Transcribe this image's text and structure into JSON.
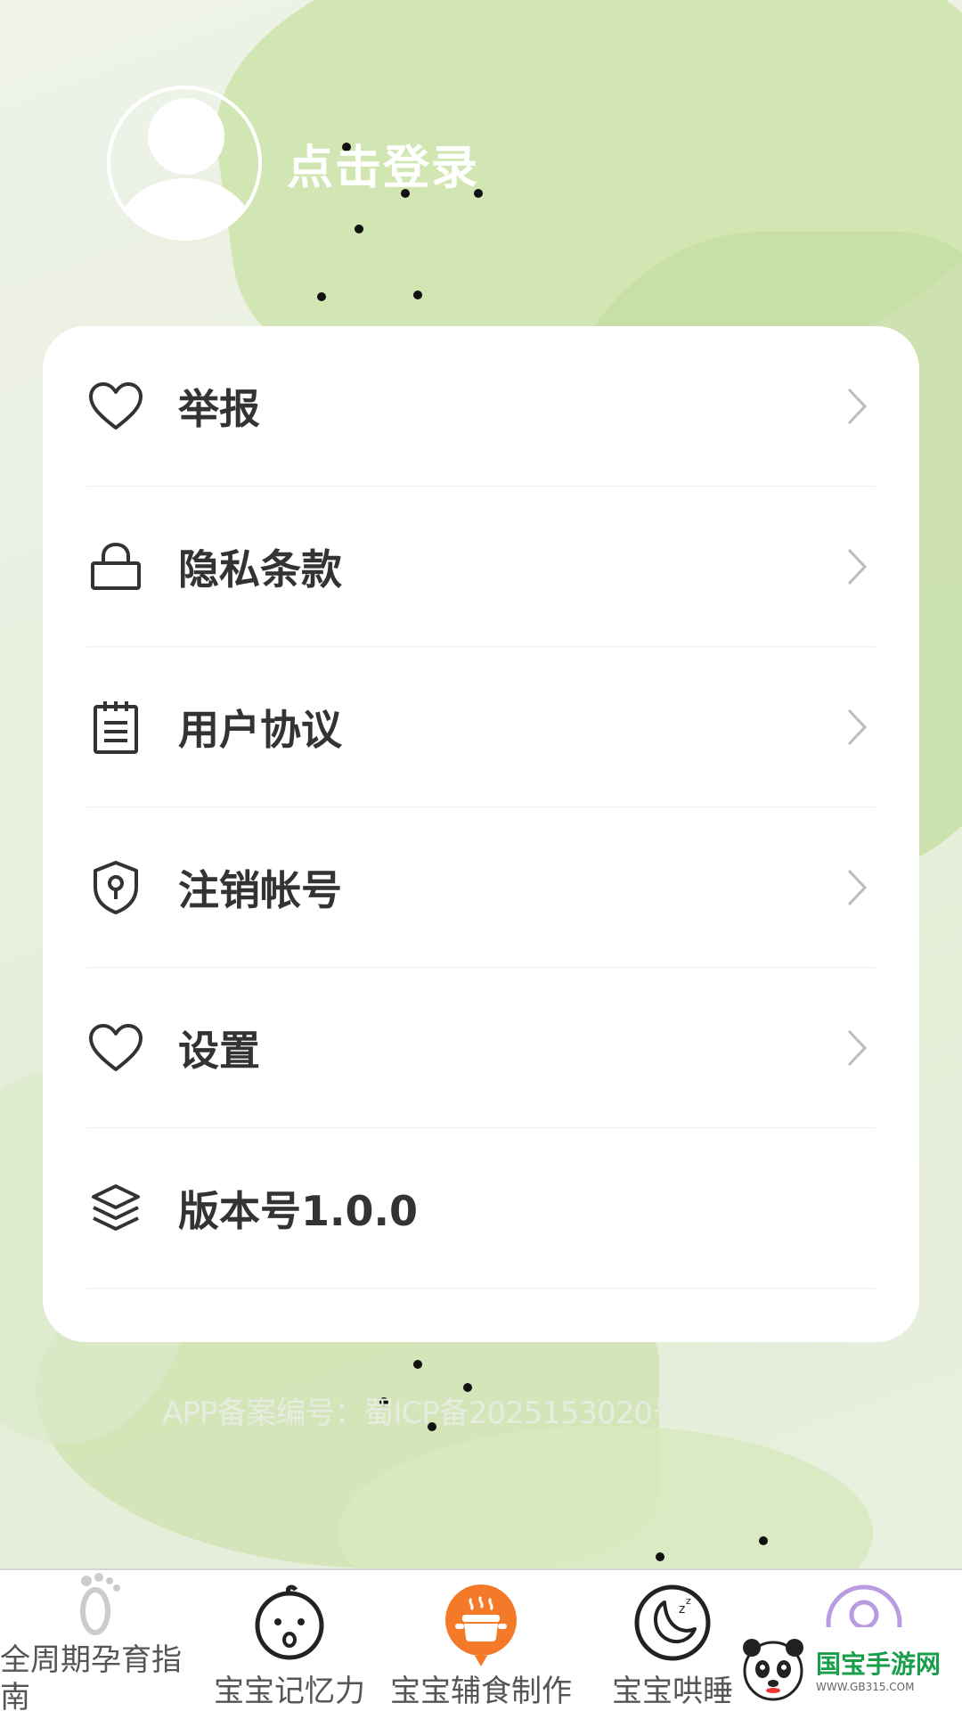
{
  "header": {
    "login_label": "点击登录"
  },
  "menu": [
    {
      "label": "举报",
      "icon": "heart-icon",
      "has_arrow": true
    },
    {
      "label": "隐私条款",
      "icon": "lock-icon",
      "has_arrow": true
    },
    {
      "label": "用户协议",
      "icon": "document-icon",
      "has_arrow": true
    },
    {
      "label": "注销帐号",
      "icon": "shield-keyhole-icon",
      "has_arrow": true
    },
    {
      "label": "设置",
      "icon": "heart-icon",
      "has_arrow": true
    },
    {
      "label": "版本号1.0.0",
      "icon": "layers-icon",
      "has_arrow": false
    }
  ],
  "footer": {
    "icp_text": "APP备案编号：蜀ICP备2025153020号-120A >"
  },
  "tabbar": {
    "tabs": [
      {
        "label": "全周期孕育指南",
        "icon": "footprint-icon"
      },
      {
        "label": "宝宝记忆力",
        "icon": "baby-face-icon"
      },
      {
        "label": "宝宝辅食制作",
        "icon": "cooking-pot-icon"
      },
      {
        "label": "宝宝哄睡",
        "icon": "moon-sleep-icon"
      },
      {
        "label": "",
        "icon": "user-profile-icon"
      }
    ]
  },
  "watermark": {
    "brand": "国宝手游网",
    "url": "WWW.GB315.COM"
  },
  "colors": {
    "accent_orange": "#f47a2a",
    "profile_purple": "#b89be0",
    "card_bg": "#ffffff",
    "bg_green": "#d2e6b4"
  }
}
